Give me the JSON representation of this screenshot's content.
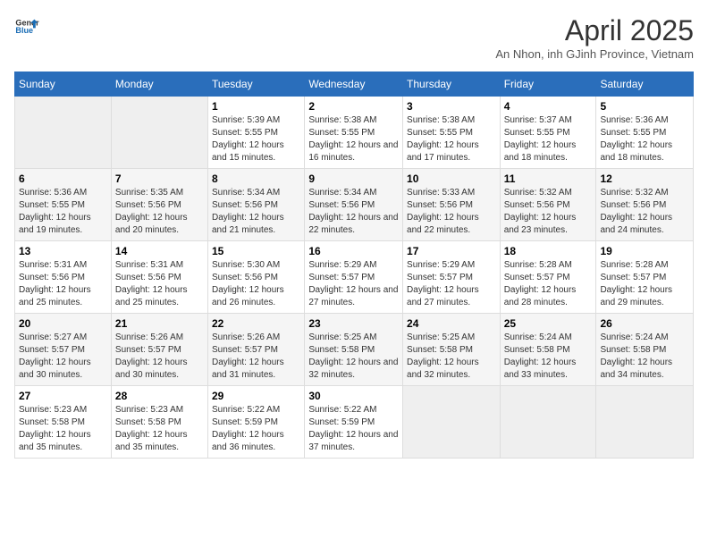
{
  "header": {
    "logo_line1": "General",
    "logo_line2": "Blue",
    "title": "April 2025",
    "subtitle": "An Nhon, inh GJinh Province, Vietnam"
  },
  "days_of_week": [
    "Sunday",
    "Monday",
    "Tuesday",
    "Wednesday",
    "Thursday",
    "Friday",
    "Saturday"
  ],
  "weeks": [
    [
      {
        "day": "",
        "sunrise": "",
        "sunset": "",
        "daylight": "",
        "empty": true
      },
      {
        "day": "",
        "sunrise": "",
        "sunset": "",
        "daylight": "",
        "empty": true
      },
      {
        "day": "1",
        "sunrise": "Sunrise: 5:39 AM",
        "sunset": "Sunset: 5:55 PM",
        "daylight": "Daylight: 12 hours and 15 minutes."
      },
      {
        "day": "2",
        "sunrise": "Sunrise: 5:38 AM",
        "sunset": "Sunset: 5:55 PM",
        "daylight": "Daylight: 12 hours and 16 minutes."
      },
      {
        "day": "3",
        "sunrise": "Sunrise: 5:38 AM",
        "sunset": "Sunset: 5:55 PM",
        "daylight": "Daylight: 12 hours and 17 minutes."
      },
      {
        "day": "4",
        "sunrise": "Sunrise: 5:37 AM",
        "sunset": "Sunset: 5:55 PM",
        "daylight": "Daylight: 12 hours and 18 minutes."
      },
      {
        "day": "5",
        "sunrise": "Sunrise: 5:36 AM",
        "sunset": "Sunset: 5:55 PM",
        "daylight": "Daylight: 12 hours and 18 minutes."
      }
    ],
    [
      {
        "day": "6",
        "sunrise": "Sunrise: 5:36 AM",
        "sunset": "Sunset: 5:55 PM",
        "daylight": "Daylight: 12 hours and 19 minutes."
      },
      {
        "day": "7",
        "sunrise": "Sunrise: 5:35 AM",
        "sunset": "Sunset: 5:56 PM",
        "daylight": "Daylight: 12 hours and 20 minutes."
      },
      {
        "day": "8",
        "sunrise": "Sunrise: 5:34 AM",
        "sunset": "Sunset: 5:56 PM",
        "daylight": "Daylight: 12 hours and 21 minutes."
      },
      {
        "day": "9",
        "sunrise": "Sunrise: 5:34 AM",
        "sunset": "Sunset: 5:56 PM",
        "daylight": "Daylight: 12 hours and 22 minutes."
      },
      {
        "day": "10",
        "sunrise": "Sunrise: 5:33 AM",
        "sunset": "Sunset: 5:56 PM",
        "daylight": "Daylight: 12 hours and 22 minutes."
      },
      {
        "day": "11",
        "sunrise": "Sunrise: 5:32 AM",
        "sunset": "Sunset: 5:56 PM",
        "daylight": "Daylight: 12 hours and 23 minutes."
      },
      {
        "day": "12",
        "sunrise": "Sunrise: 5:32 AM",
        "sunset": "Sunset: 5:56 PM",
        "daylight": "Daylight: 12 hours and 24 minutes."
      }
    ],
    [
      {
        "day": "13",
        "sunrise": "Sunrise: 5:31 AM",
        "sunset": "Sunset: 5:56 PM",
        "daylight": "Daylight: 12 hours and 25 minutes."
      },
      {
        "day": "14",
        "sunrise": "Sunrise: 5:31 AM",
        "sunset": "Sunset: 5:56 PM",
        "daylight": "Daylight: 12 hours and 25 minutes."
      },
      {
        "day": "15",
        "sunrise": "Sunrise: 5:30 AM",
        "sunset": "Sunset: 5:56 PM",
        "daylight": "Daylight: 12 hours and 26 minutes."
      },
      {
        "day": "16",
        "sunrise": "Sunrise: 5:29 AM",
        "sunset": "Sunset: 5:57 PM",
        "daylight": "Daylight: 12 hours and 27 minutes."
      },
      {
        "day": "17",
        "sunrise": "Sunrise: 5:29 AM",
        "sunset": "Sunset: 5:57 PM",
        "daylight": "Daylight: 12 hours and 27 minutes."
      },
      {
        "day": "18",
        "sunrise": "Sunrise: 5:28 AM",
        "sunset": "Sunset: 5:57 PM",
        "daylight": "Daylight: 12 hours and 28 minutes."
      },
      {
        "day": "19",
        "sunrise": "Sunrise: 5:28 AM",
        "sunset": "Sunset: 5:57 PM",
        "daylight": "Daylight: 12 hours and 29 minutes."
      }
    ],
    [
      {
        "day": "20",
        "sunrise": "Sunrise: 5:27 AM",
        "sunset": "Sunset: 5:57 PM",
        "daylight": "Daylight: 12 hours and 30 minutes."
      },
      {
        "day": "21",
        "sunrise": "Sunrise: 5:26 AM",
        "sunset": "Sunset: 5:57 PM",
        "daylight": "Daylight: 12 hours and 30 minutes."
      },
      {
        "day": "22",
        "sunrise": "Sunrise: 5:26 AM",
        "sunset": "Sunset: 5:57 PM",
        "daylight": "Daylight: 12 hours and 31 minutes."
      },
      {
        "day": "23",
        "sunrise": "Sunrise: 5:25 AM",
        "sunset": "Sunset: 5:58 PM",
        "daylight": "Daylight: 12 hours and 32 minutes."
      },
      {
        "day": "24",
        "sunrise": "Sunrise: 5:25 AM",
        "sunset": "Sunset: 5:58 PM",
        "daylight": "Daylight: 12 hours and 32 minutes."
      },
      {
        "day": "25",
        "sunrise": "Sunrise: 5:24 AM",
        "sunset": "Sunset: 5:58 PM",
        "daylight": "Daylight: 12 hours and 33 minutes."
      },
      {
        "day": "26",
        "sunrise": "Sunrise: 5:24 AM",
        "sunset": "Sunset: 5:58 PM",
        "daylight": "Daylight: 12 hours and 34 minutes."
      }
    ],
    [
      {
        "day": "27",
        "sunrise": "Sunrise: 5:23 AM",
        "sunset": "Sunset: 5:58 PM",
        "daylight": "Daylight: 12 hours and 35 minutes."
      },
      {
        "day": "28",
        "sunrise": "Sunrise: 5:23 AM",
        "sunset": "Sunset: 5:58 PM",
        "daylight": "Daylight: 12 hours and 35 minutes."
      },
      {
        "day": "29",
        "sunrise": "Sunrise: 5:22 AM",
        "sunset": "Sunset: 5:59 PM",
        "daylight": "Daylight: 12 hours and 36 minutes."
      },
      {
        "day": "30",
        "sunrise": "Sunrise: 5:22 AM",
        "sunset": "Sunset: 5:59 PM",
        "daylight": "Daylight: 12 hours and 37 minutes."
      },
      {
        "day": "",
        "sunrise": "",
        "sunset": "",
        "daylight": "",
        "empty": true
      },
      {
        "day": "",
        "sunrise": "",
        "sunset": "",
        "daylight": "",
        "empty": true
      },
      {
        "day": "",
        "sunrise": "",
        "sunset": "",
        "daylight": "",
        "empty": true
      }
    ]
  ],
  "colors": {
    "header_bg": "#2a6ebb",
    "accent": "#1a6db5"
  }
}
